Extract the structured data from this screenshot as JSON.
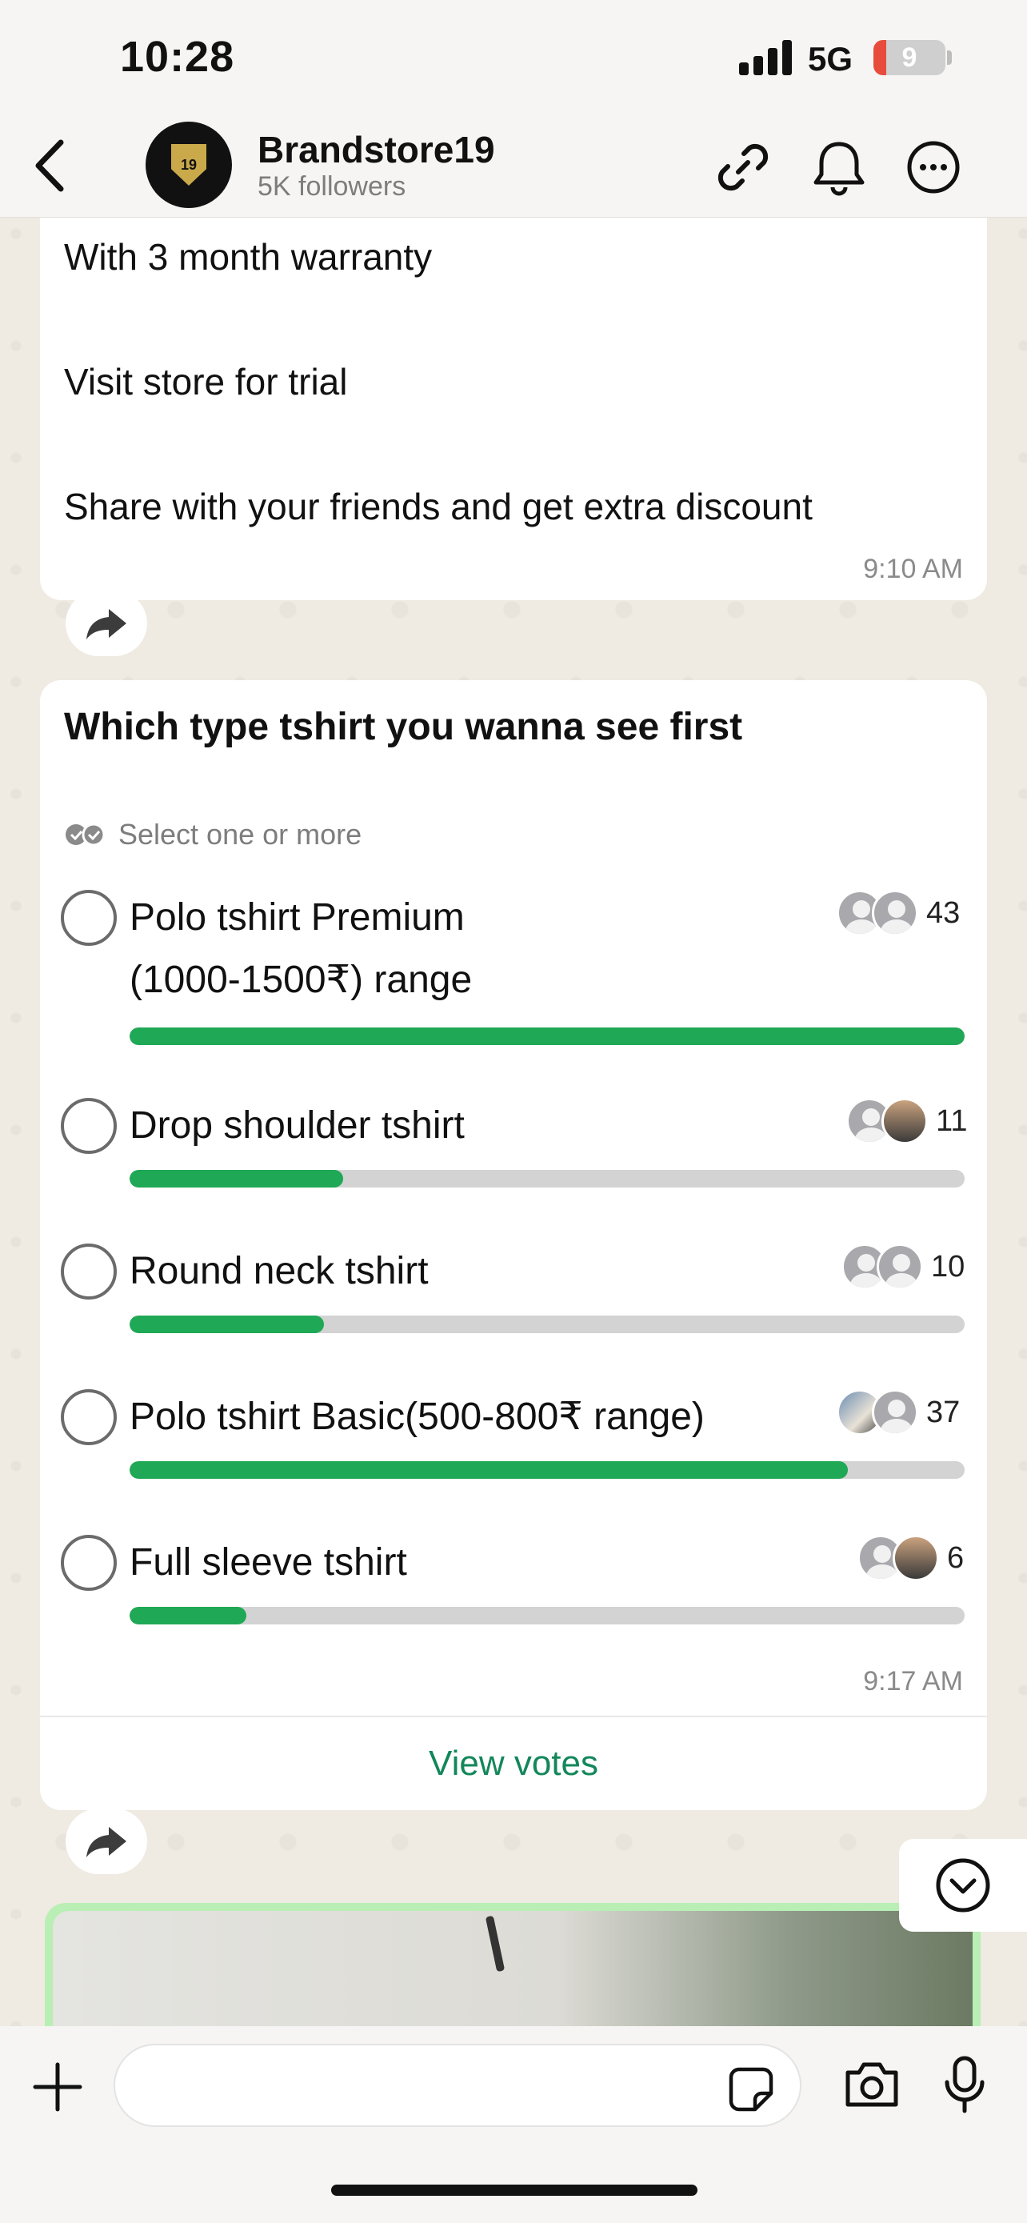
{
  "status_bar": {
    "time": "10:28",
    "network": "5G",
    "battery": "9"
  },
  "header": {
    "channel_name": "Brandstore19",
    "followers": "5K followers",
    "avatar_text": "19"
  },
  "message": {
    "lines": [
      "With 3 month warranty",
      "Visit store for trial",
      "Share with your friends and get extra discount"
    ],
    "time": "9:10 AM"
  },
  "poll": {
    "question": "Which type tshirt you wanna see first",
    "hint": "Select one or more",
    "options": [
      {
        "label_line1": "Polo tshirt Premium",
        "label_line2": "(1000-1500₹) range",
        "votes": "43",
        "fill_percent": 100
      },
      {
        "label_line1": "Drop shoulder tshirt",
        "votes": "11",
        "fill_percent": 25.6
      },
      {
        "label_line1": "Round neck tshirt",
        "votes": "10",
        "fill_percent": 23.3
      },
      {
        "label_line1": "Polo tshirt Basic(500-800₹ range)",
        "votes": "37",
        "fill_percent": 86
      },
      {
        "label_line1": "Full sleeve tshirt",
        "votes": "6",
        "fill_percent": 14
      }
    ],
    "time": "9:17 AM",
    "view_votes": "View votes"
  },
  "colors": {
    "accent_green": "#1fa855",
    "link_green": "#13875a",
    "background": "#efeae2"
  }
}
